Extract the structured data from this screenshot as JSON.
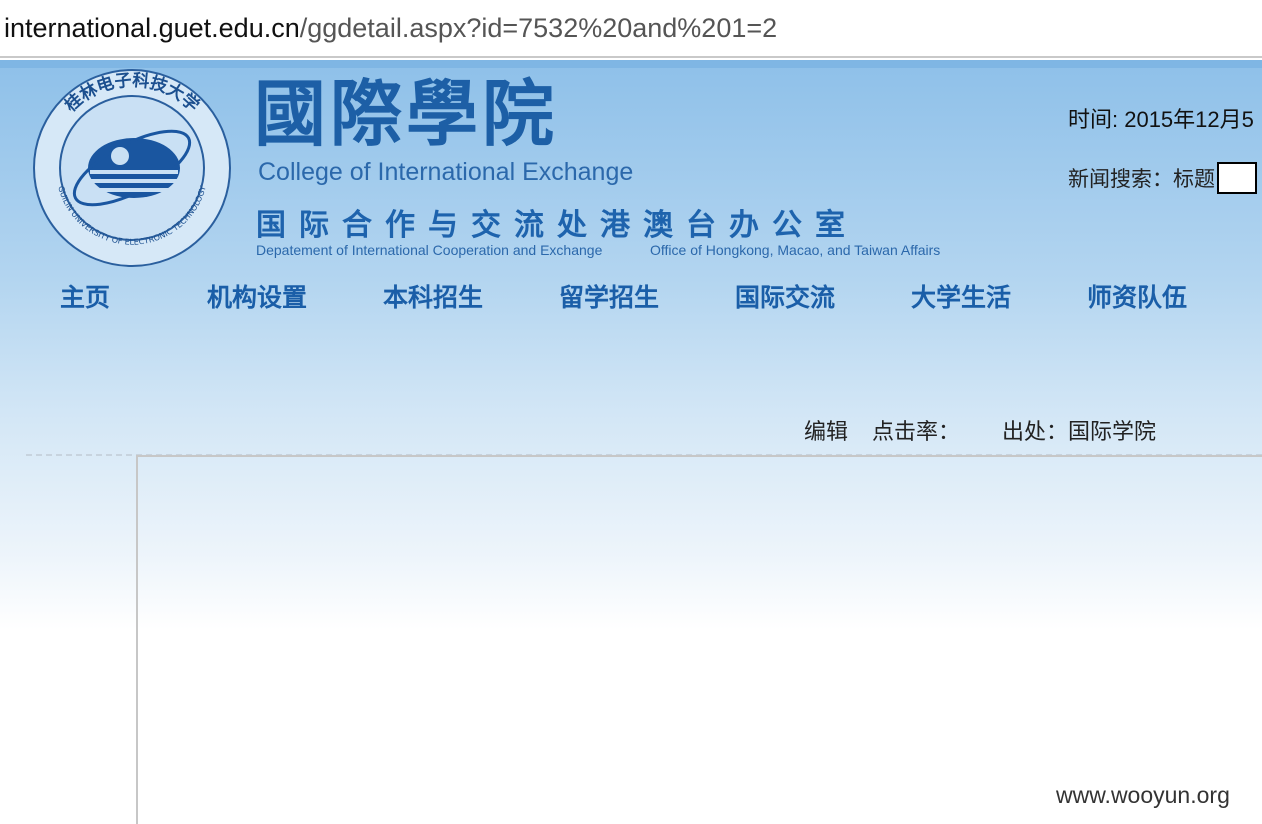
{
  "browser": {
    "url_host": "international.guet.edu.cn",
    "url_path": "/ggdetail.aspx?id=7532%20and%201=2"
  },
  "header": {
    "title_cn": "國際學院",
    "title_en": "College of International Exchange",
    "dept_cn": "国际合作与交流处港澳台办公室",
    "dept_en_1": "Depatement of International Cooperation and Exchange",
    "dept_en_2": "Office of Hongkong, Macao, and Taiwan Affairs",
    "emblem_text_top": "桂林电子科技大学",
    "emblem_text_bottom": "GUILIN UNIVERSITY OF ELECTRONIC TECHNOLOGY",
    "date_text": "时间: 2015年12月5",
    "search_label": "新闻搜索：标题"
  },
  "nav": {
    "items": [
      {
        "label": "主页"
      },
      {
        "label": "机构设置"
      },
      {
        "label": "本科招生"
      },
      {
        "label": "留学招生"
      },
      {
        "label": "国际交流"
      },
      {
        "label": "大学生活"
      },
      {
        "label": "师资队伍"
      }
    ]
  },
  "article_meta": {
    "editor_label": "编辑",
    "clicks_label": "点击率：",
    "source_label": "出处：国际学院"
  },
  "watermark": "www.wooyun.org",
  "colors": {
    "accent_blue": "#1d5fa6",
    "header_bg": "#8ec0e9"
  }
}
